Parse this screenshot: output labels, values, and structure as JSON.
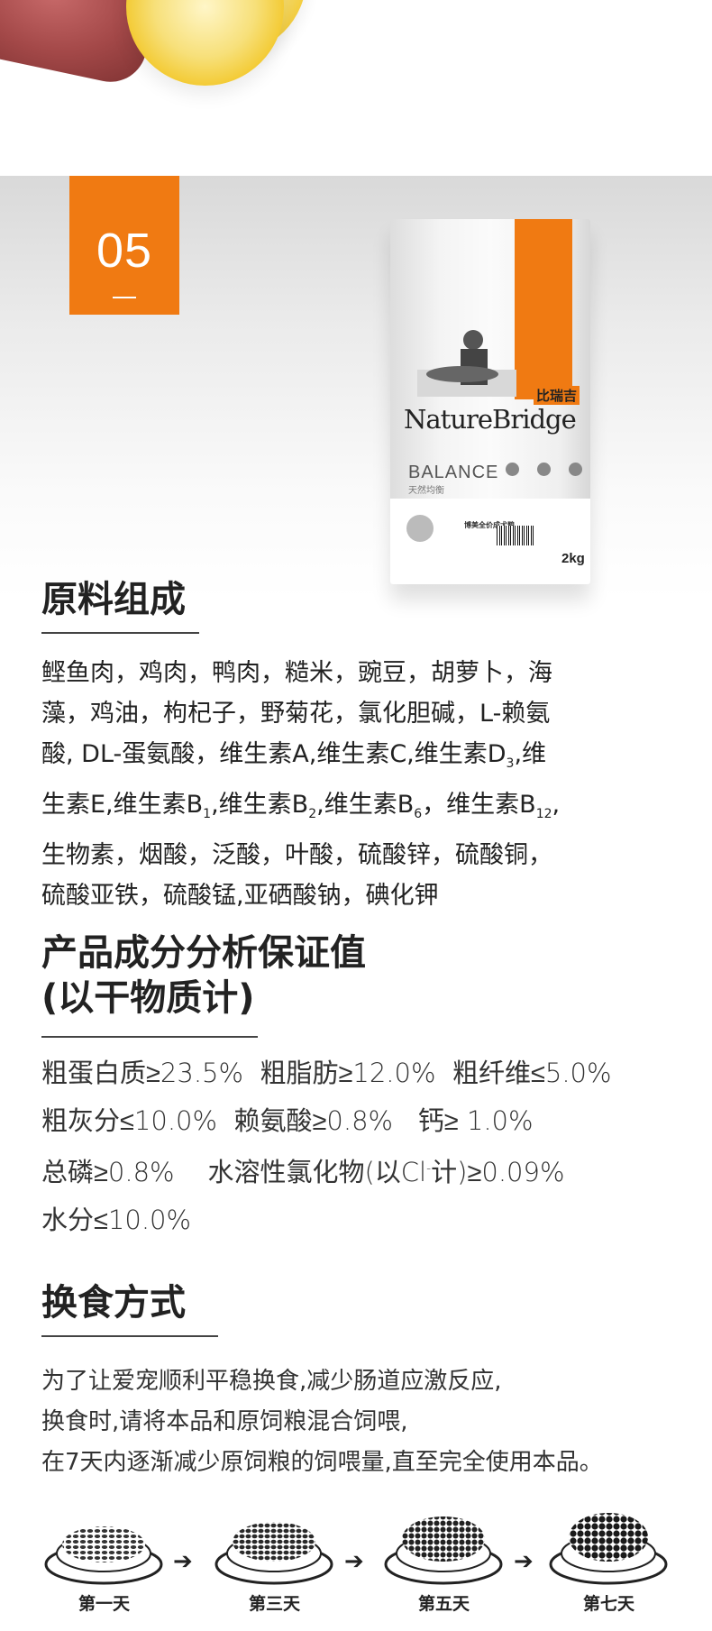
{
  "section_number": "05",
  "bag": {
    "brand_cn": "比瑞吉",
    "brand_en": "NatureBridge",
    "line_en": "BALANCE",
    "line_cn": "天然均衡",
    "product_cn": "博美全价成犬粮",
    "weight": "2kg"
  },
  "ingredients": {
    "heading": "原料组成",
    "lines": [
      "鲣鱼肉，鸡肉，鸭肉，糙米，豌豆，胡萝卜，海",
      "藻，鸡油，枸杞子，野菊花，氯化胆碱，L-赖氨",
      "酸, DL-蛋氨酸，维生素A,维生素C,维生素D",
      "生素E,维生素B",
      "生物素，烟酸，泛酸，叶酸，硫酸锌，硫酸铜，",
      "硫酸亚铁，硫酸锰,亚硒酸钠，碘化钾"
    ],
    "line3_sub": "3",
    "line3_tail": ",维",
    "line4_sub1": "1",
    "line4_mid1": ",维生素B",
    "line4_sub2": "2",
    "line4_mid2": ",维生素B",
    "line4_sub3": "6",
    "line4_mid3": "，维生素B",
    "line4_sub4": "12",
    "line4_tail": ","
  },
  "guarantee": {
    "heading_line1": "产品成分分析保证值",
    "heading_line2": "(以干物质计)",
    "rows": [
      [
        "粗蛋白质≥23.5%",
        "粗脂肪≥12.0%",
        "粗纤维≤5.0%"
      ],
      [
        "粗灰分≤10.0%",
        "赖氨酸≥0.8%",
        "钙≥ 1.0%"
      ],
      [
        "总磷≥0.8%",
        "水溶性氯化物(以Cl",
        "计)≥0.09%"
      ],
      [
        "水分≤10.0%"
      ]
    ],
    "cl_sup": "-"
  },
  "switching": {
    "heading": "换食方式",
    "lines": [
      "为了让爱宠顺利平稳换食,减少肠道应激反应,",
      "换食时,请将本品和原饲粮混合饲喂,",
      "在7天内逐渐减少原饲粮的饲喂量,直至完全使用本品。"
    ],
    "steps": [
      {
        "label": "第一天",
        "new_ratio": 0.25
      },
      {
        "label": "第三天",
        "new_ratio": 0.5
      },
      {
        "label": "第五天",
        "new_ratio": 0.75
      },
      {
        "label": "第七天",
        "new_ratio": 1.0
      }
    ],
    "arrow": "➔"
  },
  "colors": {
    "accent": "#f07a12",
    "text": "#222222"
  }
}
